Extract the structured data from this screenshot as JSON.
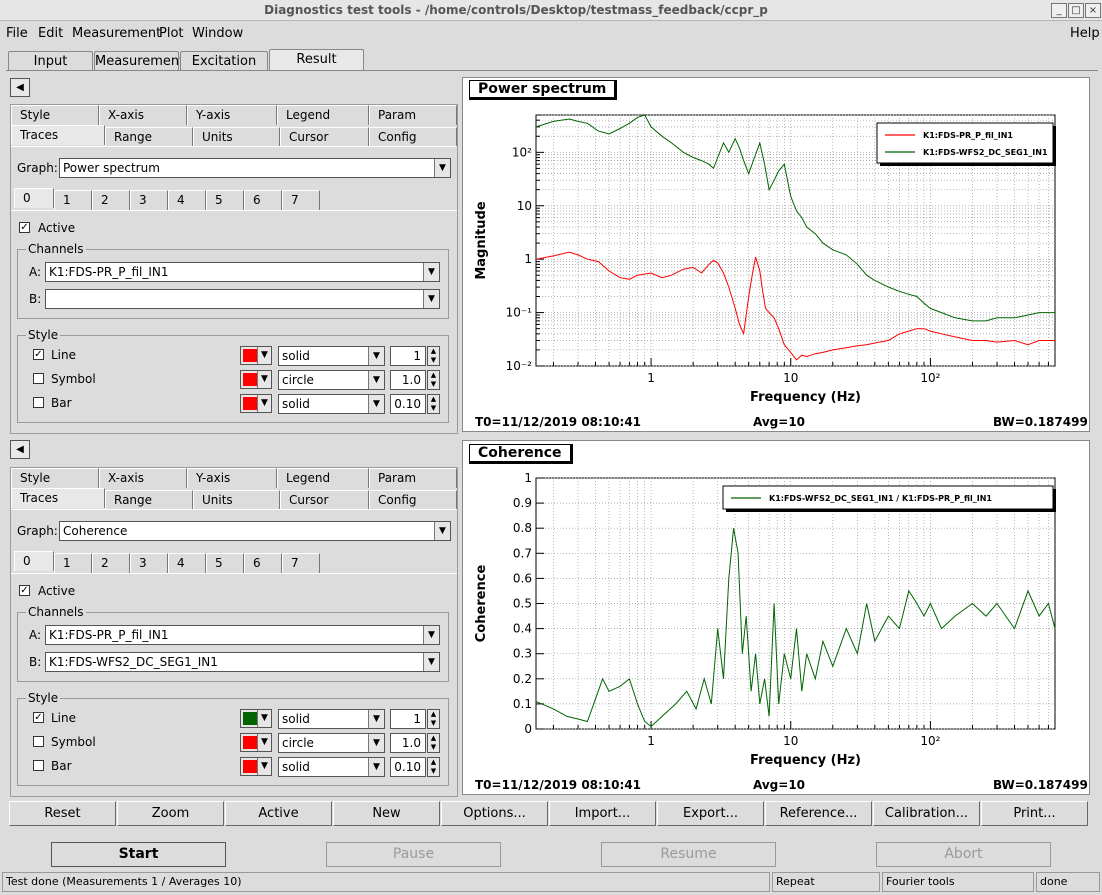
{
  "window": {
    "title": "Diagnostics test tools - /home/controls/Desktop/testmass_feedback/ccpr_p",
    "btn_min": "_",
    "btn_max": "□",
    "btn_close": "×"
  },
  "menu": {
    "file": "File",
    "edit": "Edit",
    "measurement": "Measurement",
    "plot": "Plot",
    "window": "Window",
    "help": "Help"
  },
  "tabs": {
    "input": "Input",
    "measurement": "Measurement",
    "excitation": "Excitation",
    "result": "Result"
  },
  "collapse_arrow": "◀",
  "panels": [
    {
      "tabs_top": [
        "Style",
        "X-axis",
        "Y-axis",
        "Legend",
        "Param"
      ],
      "tabs_bottom": [
        "Traces",
        "Range",
        "Units",
        "Cursor",
        "Config"
      ],
      "graph_label": "Graph:",
      "graph_value": "Power spectrum",
      "trace_tabs": [
        "0",
        "1",
        "2",
        "3",
        "4",
        "5",
        "6",
        "7"
      ],
      "active_label": "Active",
      "channels_label": "Channels",
      "a_label": "A:",
      "a_value": "K1:FDS-PR_P_fil_IN1",
      "b_label": "B:",
      "b_value": "",
      "style_label": "Style",
      "line_label": "Line",
      "line_color": "#ff0000",
      "line_style": "solid",
      "line_width": "1",
      "symbol_label": "Symbol",
      "symbol_color": "#ff0000",
      "symbol_style": "circle",
      "symbol_size": "1.0",
      "bar_label": "Bar",
      "bar_color": "#ff0000",
      "bar_style": "solid",
      "bar_width": "0.10"
    },
    {
      "tabs_top": [
        "Style",
        "X-axis",
        "Y-axis",
        "Legend",
        "Param"
      ],
      "tabs_bottom": [
        "Traces",
        "Range",
        "Units",
        "Cursor",
        "Config"
      ],
      "graph_label": "Graph:",
      "graph_value": "Coherence",
      "trace_tabs": [
        "0",
        "1",
        "2",
        "3",
        "4",
        "5",
        "6",
        "7"
      ],
      "active_label": "Active",
      "channels_label": "Channels",
      "a_label": "A:",
      "a_value": "K1:FDS-PR_P_fil_IN1",
      "b_label": "B:",
      "b_value": "K1:FDS-WFS2_DC_SEG1_IN1",
      "style_label": "Style",
      "line_label": "Line",
      "line_color": "#006400",
      "line_style": "solid",
      "line_width": "1",
      "symbol_label": "Symbol",
      "symbol_color": "#ff0000",
      "symbol_style": "circle",
      "symbol_size": "1.0",
      "bar_label": "Bar",
      "bar_color": "#ff0000",
      "bar_style": "solid",
      "bar_width": "0.10"
    }
  ],
  "plots": [
    {
      "label": "Power spectrum",
      "t0": "T0=11/12/2019 08:10:41",
      "avg": "Avg=10",
      "bw": "BW=0.187499"
    },
    {
      "label": "Coherence",
      "t0": "T0=11/12/2019 08:10:41",
      "avg": "Avg=10",
      "bw": "BW=0.187499"
    }
  ],
  "chart_data": [
    {
      "type": "line",
      "title": "Power spectrum",
      "xlabel": "Frequency (Hz)",
      "ylabel": "Magnitude",
      "xscale": "log",
      "yscale": "log",
      "xlim": [
        0.15,
        780
      ],
      "ylim": [
        0.01,
        500
      ],
      "x_tick_labels": [
        "1",
        "10",
        "10²"
      ],
      "y_tick_labels": [
        "10⁻²",
        "10⁻¹",
        "1",
        "10",
        "10²"
      ],
      "grid": true,
      "legend": "top-right",
      "series": [
        {
          "name": "K1:FDS-PR_P_fil_IN1",
          "color": "#ff0000",
          "x": [
            0.15,
            0.2,
            0.26,
            0.3,
            0.35,
            0.42,
            0.5,
            0.6,
            0.7,
            0.8,
            1.0,
            1.2,
            1.4,
            1.7,
            2.0,
            2.3,
            2.6,
            2.8,
            3.0,
            3.3,
            3.6,
            4.0,
            4.3,
            4.6,
            5.0,
            5.3,
            5.6,
            6.0,
            6.3,
            6.6,
            7.0,
            7.6,
            8.2,
            9.0,
            10,
            11,
            12,
            13,
            15,
            17,
            20,
            25,
            30,
            35,
            40,
            50,
            60,
            70,
            80,
            90,
            100,
            120,
            150,
            200,
            250,
            300,
            400,
            500,
            600,
            700,
            780
          ],
          "y": [
            1.0,
            1.15,
            1.35,
            1.2,
            1.0,
            0.9,
            0.6,
            0.45,
            0.42,
            0.5,
            0.55,
            0.45,
            0.5,
            0.65,
            0.7,
            0.55,
            0.8,
            0.95,
            0.85,
            0.55,
            0.3,
            0.12,
            0.06,
            0.04,
            0.2,
            0.5,
            1.1,
            0.6,
            0.25,
            0.12,
            0.1,
            0.08,
            0.05,
            0.025,
            0.018,
            0.013,
            0.016,
            0.015,
            0.017,
            0.018,
            0.02,
            0.022,
            0.024,
            0.025,
            0.027,
            0.03,
            0.04,
            0.045,
            0.05,
            0.05,
            0.045,
            0.04,
            0.035,
            0.03,
            0.03,
            0.028,
            0.03,
            0.025,
            0.03,
            0.03,
            0.03
          ]
        },
        {
          "name": "K1:FDS-WFS2_DC_SEG1_IN1",
          "color": "#006400",
          "x": [
            0.15,
            0.2,
            0.26,
            0.3,
            0.35,
            0.42,
            0.5,
            0.6,
            0.7,
            0.8,
            0.9,
            1.0,
            1.2,
            1.4,
            1.7,
            2.0,
            2.3,
            2.6,
            2.8,
            3.0,
            3.3,
            3.6,
            4.0,
            4.3,
            4.6,
            5.0,
            5.5,
            6.0,
            6.5,
            7.0,
            7.6,
            8.2,
            9.0,
            10,
            11,
            12,
            13,
            15,
            17,
            20,
            25,
            30,
            35,
            40,
            50,
            60,
            70,
            80,
            90,
            100,
            120,
            150,
            200,
            250,
            300,
            400,
            500,
            600,
            700,
            780
          ],
          "y": [
            300,
            380,
            420,
            380,
            350,
            250,
            220,
            280,
            350,
            450,
            500,
            300,
            200,
            150,
            100,
            80,
            70,
            60,
            50,
            80,
            150,
            100,
            180,
            120,
            70,
            40,
            80,
            150,
            60,
            20,
            30,
            45,
            60,
            15,
            8,
            6,
            4,
            3,
            2,
            1.5,
            1.2,
            0.8,
            0.5,
            0.4,
            0.3,
            0.25,
            0.22,
            0.2,
            0.15,
            0.12,
            0.1,
            0.08,
            0.07,
            0.07,
            0.08,
            0.08,
            0.09,
            0.1,
            0.1,
            0.1
          ]
        }
      ]
    },
    {
      "type": "line",
      "title": "Coherence",
      "xlabel": "Frequency (Hz)",
      "ylabel": "Coherence",
      "xscale": "log",
      "yscale": "linear",
      "xlim": [
        0.15,
        780
      ],
      "ylim": [
        0,
        1
      ],
      "x_tick_labels": [
        "1",
        "10",
        "10²"
      ],
      "y_tick_labels": [
        "0",
        "0.1",
        "0.2",
        "0.3",
        "0.4",
        "0.5",
        "0.6",
        "0.7",
        "0.8",
        "0.9",
        "1"
      ],
      "grid": true,
      "legend": "top-right",
      "series": [
        {
          "name": "K1:FDS-WFS2_DC_SEG1_IN1 / K1:FDS-PR_P_fil_IN1",
          "color": "#006400",
          "x": [
            0.15,
            0.2,
            0.25,
            0.3,
            0.35,
            0.4,
            0.45,
            0.5,
            0.6,
            0.7,
            0.8,
            0.9,
            1.0,
            1.2,
            1.5,
            1.8,
            2.1,
            2.4,
            2.7,
            3.0,
            3.3,
            3.6,
            3.9,
            4.2,
            4.5,
            4.8,
            5.2,
            5.6,
            6.0,
            6.5,
            7.0,
            7.6,
            8.2,
            9.0,
            10,
            11,
            12,
            13,
            15,
            17,
            20,
            25,
            30,
            35,
            40,
            50,
            60,
            70,
            80,
            90,
            100,
            120,
            150,
            200,
            250,
            300,
            400,
            500,
            600,
            700,
            780
          ],
          "y": [
            0.11,
            0.08,
            0.05,
            0.04,
            0.03,
            0.12,
            0.2,
            0.15,
            0.17,
            0.2,
            0.1,
            0.03,
            0.01,
            0.05,
            0.1,
            0.15,
            0.08,
            0.2,
            0.1,
            0.4,
            0.2,
            0.6,
            0.8,
            0.7,
            0.3,
            0.45,
            0.15,
            0.3,
            0.1,
            0.2,
            0.05,
            0.5,
            0.1,
            0.3,
            0.2,
            0.4,
            0.15,
            0.3,
            0.2,
            0.35,
            0.25,
            0.4,
            0.3,
            0.5,
            0.35,
            0.45,
            0.4,
            0.55,
            0.5,
            0.45,
            0.5,
            0.4,
            0.45,
            0.5,
            0.45,
            0.5,
            0.4,
            0.55,
            0.45,
            0.5,
            0.4
          ]
        }
      ]
    }
  ],
  "bottom_buttons": [
    "Reset",
    "Zoom",
    "Active",
    "New",
    "Options...",
    "Import...",
    "Export...",
    "Reference...",
    "Calibration...",
    "Print..."
  ],
  "controls": {
    "start": "Start",
    "pause": "Pause",
    "resume": "Resume",
    "abort": "Abort"
  },
  "status": {
    "main": "Test done (Measurements 1 / Averages 10)",
    "repeat": "Repeat",
    "mode": "Fourier tools",
    "state": "done"
  }
}
